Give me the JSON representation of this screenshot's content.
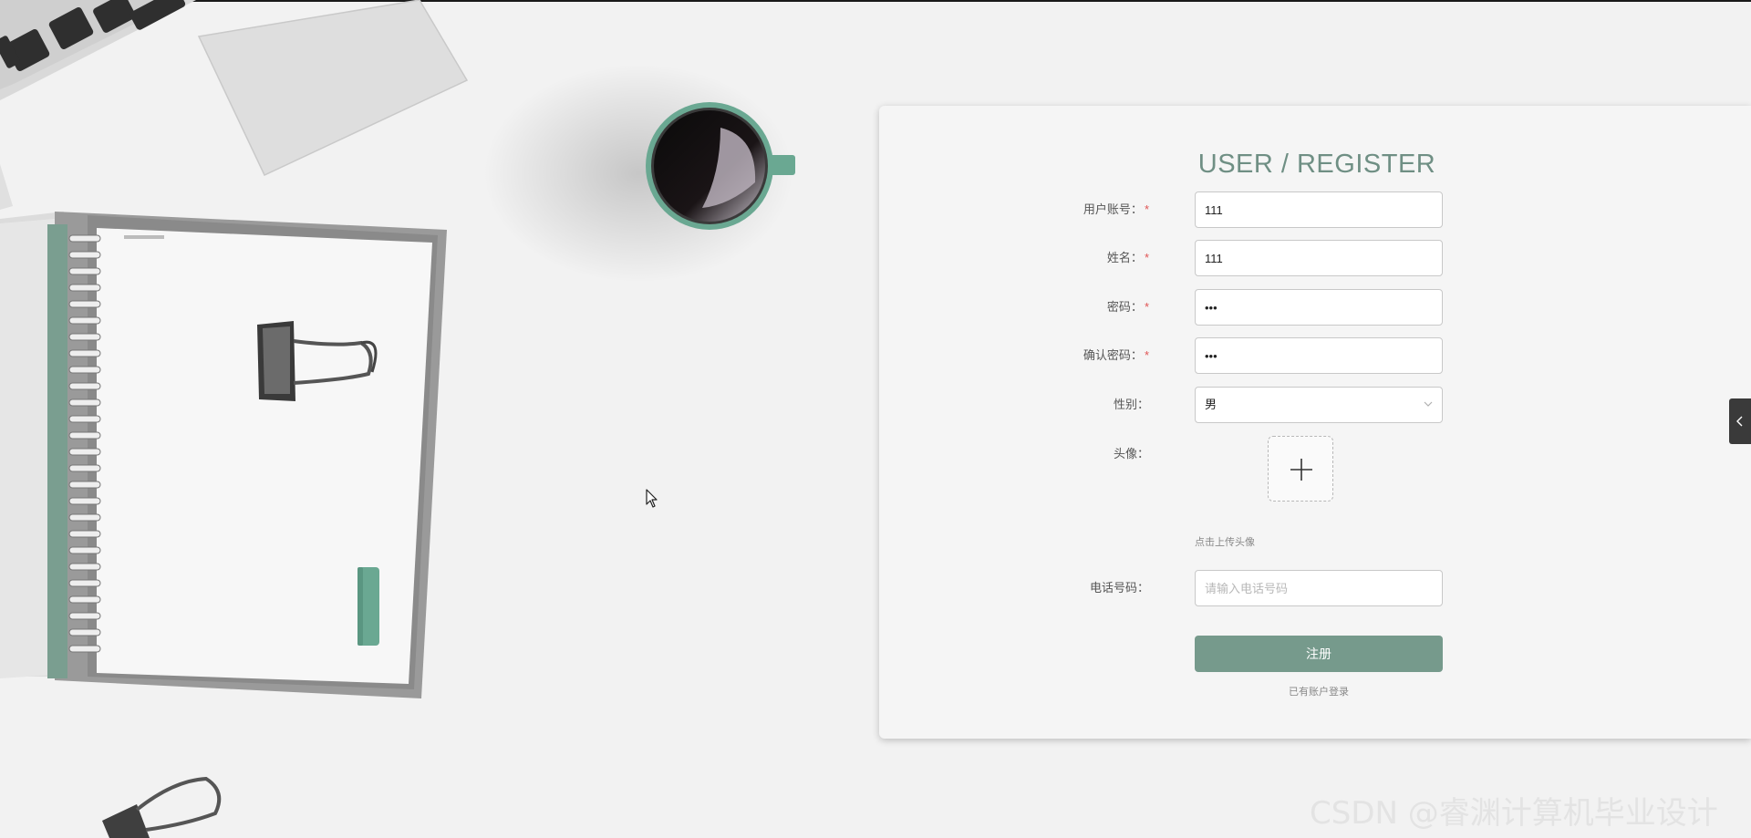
{
  "register": {
    "title": "USER / REGISTER",
    "required_mark": "*",
    "fields": [
      {
        "label": "用户账号：",
        "required": true,
        "value": "111"
      },
      {
        "label": "姓名：",
        "required": true,
        "value": "111"
      },
      {
        "label": "密码：",
        "required": true,
        "value": "•••"
      },
      {
        "label": "确认密码：",
        "required": true,
        "value": "•••"
      }
    ],
    "gender": {
      "label": "性别：",
      "value": "男"
    },
    "avatar": {
      "label": "头像：",
      "tip": "点击上传头像"
    },
    "phone": {
      "label": "电话号码：",
      "value": "",
      "placeholder": "请输入电话号码"
    },
    "submit_label": "注册",
    "login_link": "已有账户登录"
  },
  "watermark": "CSDN @睿渊计算机毕业设计",
  "colors": {
    "accent": "#769a8c",
    "title": "#6f8f84",
    "required": "#e05555",
    "background": "#f2f2f2"
  },
  "icons": {
    "upload": "plus-icon",
    "select": "chevron-down-icon",
    "side_tab": "chevron-left-icon"
  }
}
